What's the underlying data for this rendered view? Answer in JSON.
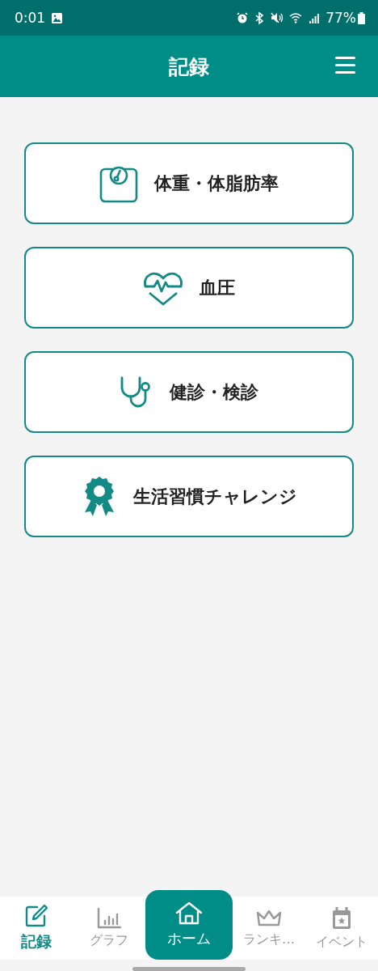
{
  "status_bar": {
    "time": "0:01",
    "battery": "77%"
  },
  "header": {
    "title": "記録"
  },
  "menu_cards": [
    {
      "label": "体重・体脂肪率"
    },
    {
      "label": "血圧"
    },
    {
      "label": "健診・検診"
    },
    {
      "label": "生活習慣チャレンジ"
    }
  ],
  "bottom_nav": [
    {
      "label": "記録",
      "selected": true,
      "kind": "tab"
    },
    {
      "label": "グラフ",
      "selected": false,
      "kind": "tab"
    },
    {
      "label": "ホーム",
      "selected": false,
      "kind": "center"
    },
    {
      "label": "ランキ…",
      "selected": false,
      "kind": "tab"
    },
    {
      "label": "イベント",
      "selected": false,
      "kind": "tab"
    }
  ]
}
